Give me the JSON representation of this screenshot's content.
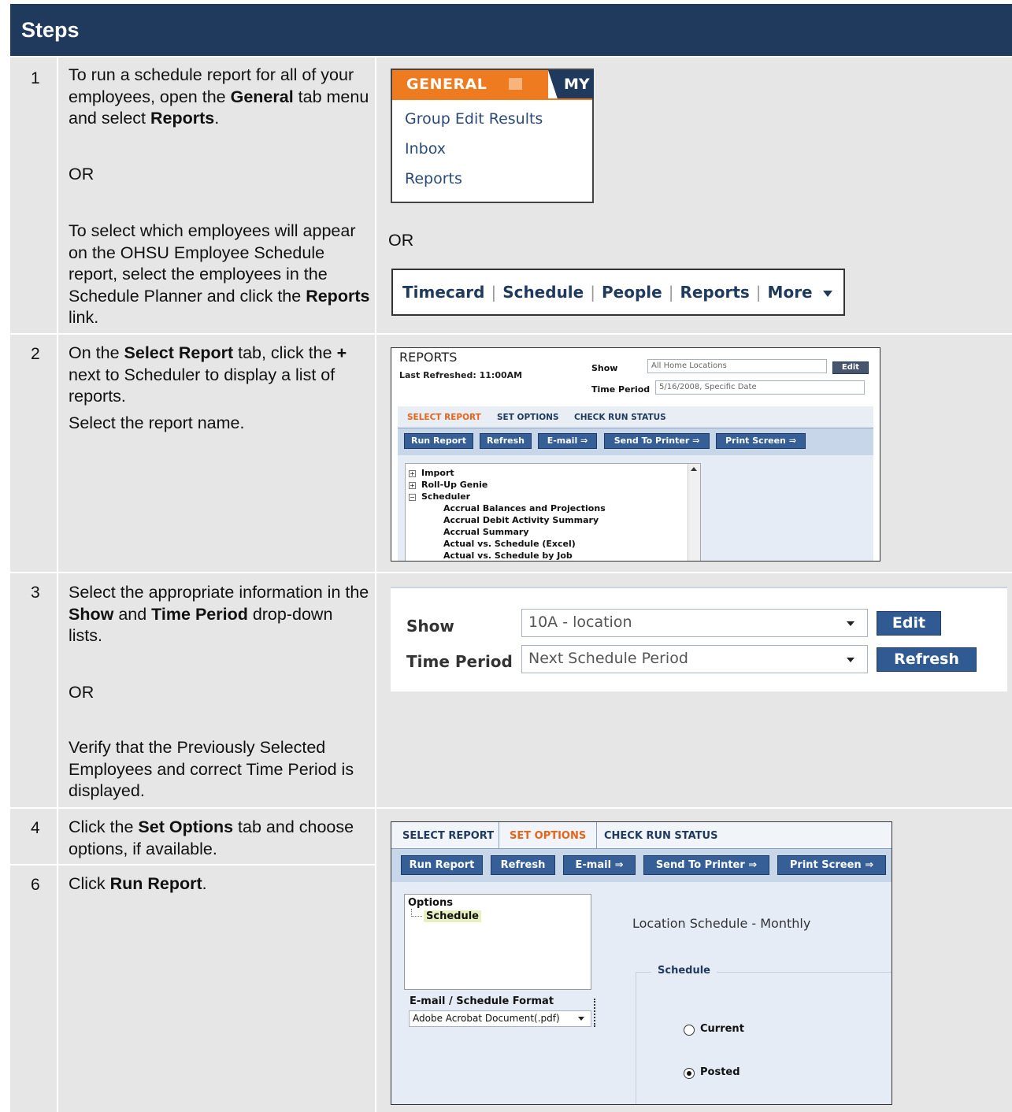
{
  "header": {
    "title": "Steps"
  },
  "steps": {
    "s1": {
      "num": "1",
      "text_a1": "To run a schedule report for all of your employees, open the ",
      "text_a_b1": "General",
      "text_a2": " tab menu and select ",
      "text_a_b2": "Reports",
      "text_a3": ".",
      "or": "OR",
      "text_b1": "To select which employees will appear on the OHSU Employee Schedule report, select the employees in the Schedule Planner and click the ",
      "text_b_b": "Reports",
      "text_b2": " link."
    },
    "s2": {
      "num": "2",
      "text1": "On the ",
      "text_b1": "Select Report",
      "text2": " tab, click the ",
      "text_b2": "+",
      "text3": " next to Scheduler to display a list of reports.",
      "text4": "Select the report name."
    },
    "s3": {
      "num": "3",
      "text1": "Select the appropriate information in the ",
      "text_b1": "Show",
      "text2": " and ",
      "text_b2": "Time Period",
      "text3": " drop-down lists.",
      "or": "OR",
      "text4": "Verify that the Previously Selected Employees and correct Time Period is displayed."
    },
    "s4": {
      "num": "4",
      "text1": "Click the ",
      "text_b1": "Set Options",
      "text2": " tab and choose options, if available."
    },
    "s6": {
      "num": "6",
      "text1": "Click ",
      "text_b1": "Run Report",
      "text2": "."
    }
  },
  "shot1": {
    "tab_general": "GENERAL",
    "tab_my": "MY",
    "items": [
      "Group Edit Results",
      "Inbox",
      "Reports"
    ]
  },
  "shot_or": "OR",
  "shot1b": {
    "links": [
      "Timecard",
      "Schedule",
      "People",
      "Reports",
      "More"
    ]
  },
  "shot2": {
    "title": "REPORTS",
    "last_refreshed": "Last Refreshed: 11:00AM",
    "show_label": "Show",
    "show_value": "All Home Locations",
    "edit": "Edit",
    "time_label": "Time Period",
    "time_value": "5/16/2008, Specific Date",
    "tabs": [
      "SELECT REPORT",
      "SET OPTIONS",
      "CHECK RUN STATUS"
    ],
    "buttons": [
      "Run Report",
      "Refresh",
      "E-mail ⇒",
      "Send To Printer ⇒",
      "Print Screen ⇒"
    ],
    "tree": [
      "Import",
      "Roll-Up Genie",
      "Scheduler"
    ],
    "reports": [
      "Accrual Balances and Projections",
      "Accrual Debit Activity Summary",
      "Accrual Summary",
      "Actual vs. Schedule (Excel)",
      "Actual vs. Schedule by Job"
    ]
  },
  "shot3": {
    "show_label": "Show",
    "show_value": "10A - location",
    "edit": "Edit",
    "time_label": "Time Period",
    "time_value": "Next Schedule Period",
    "refresh": "Refresh"
  },
  "shot4": {
    "tabs": [
      "SELECT REPORT",
      "SET OPTIONS",
      "CHECK RUN STATUS"
    ],
    "buttons": [
      "Run Report",
      "Refresh",
      "E-mail ⇒",
      "Send To Printer ⇒",
      "Print Screen ⇒"
    ],
    "options_label": "Options",
    "options_item": "Schedule",
    "format_label": "E-mail / Schedule Format",
    "format_value": "Adobe Acrobat Document(.pdf)",
    "report_title": "Location Schedule - Monthly",
    "group_label": "Schedule",
    "radio_current": "Current",
    "radio_posted": "Posted"
  }
}
